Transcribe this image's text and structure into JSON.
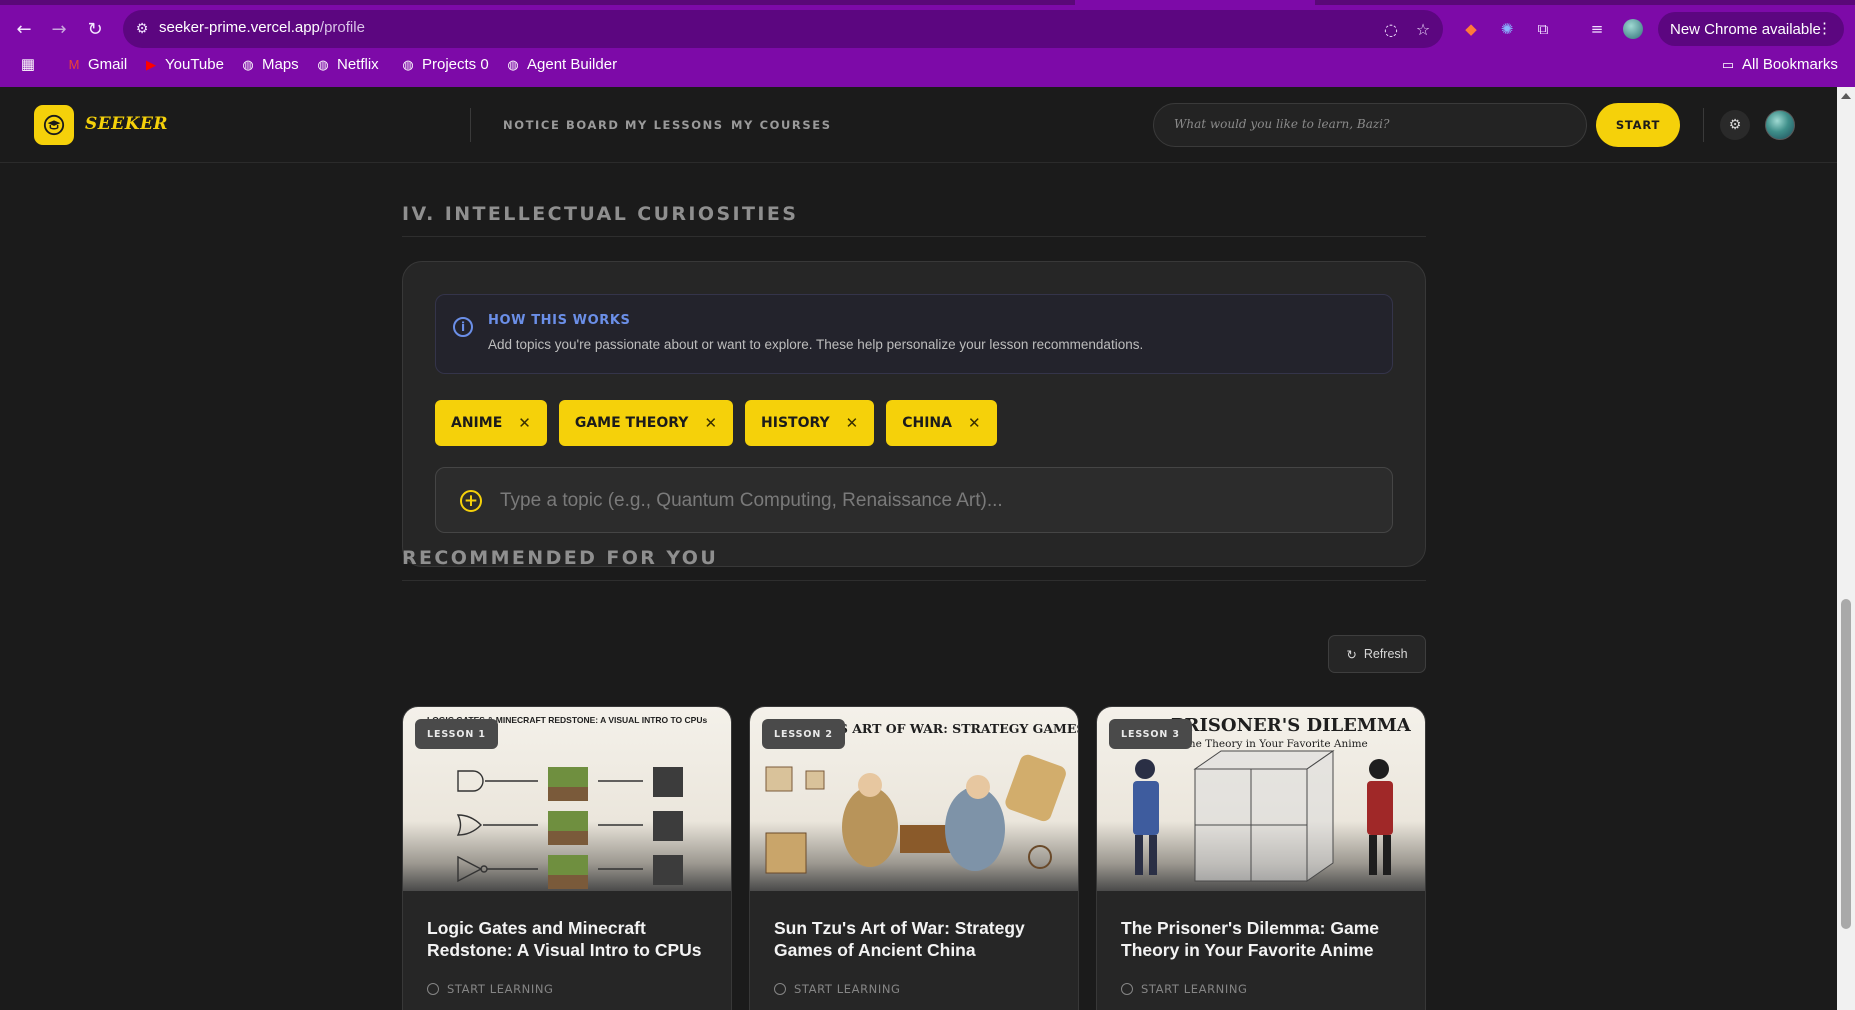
{
  "browser": {
    "url_host": "seeker-prime.vercel.app",
    "url_path": "/profile",
    "new_chrome_label": "New Chrome available",
    "bookmarks": [
      {
        "label": "Gmail",
        "icon": "gmail-icon"
      },
      {
        "label": "YouTube",
        "icon": "youtube-icon"
      },
      {
        "label": "Maps",
        "icon": "globe-icon"
      },
      {
        "label": "Netflix",
        "icon": "globe-icon"
      },
      {
        "label": "Projects 0",
        "icon": "globe-icon"
      },
      {
        "label": "Agent Builder",
        "icon": "globe-icon"
      }
    ],
    "all_bookmarks_label": "All Bookmarks"
  },
  "header": {
    "logo_text": "SEEKER",
    "nav": [
      "NOTICE BOARD",
      "MY LESSONS",
      "MY COURSES"
    ],
    "search_placeholder": "What would you like to learn, Bazi?",
    "start_label": "START"
  },
  "interests": {
    "section_title": "IV. INTELLECTUAL CURIOSITIES",
    "info_title": "HOW THIS WORKS",
    "info_text": "Add topics you're passionate about or want to explore. These help personalize your lesson recommendations.",
    "chips": [
      "ANIME",
      "GAME THEORY",
      "HISTORY",
      "CHINA"
    ],
    "input_placeholder": "Type a topic (e.g., Quantum Computing, Renaissance Art)..."
  },
  "recommended": {
    "section_title": "RECOMMENDED FOR YOU",
    "refresh_label": "Refresh",
    "lessons": [
      {
        "badge": "LESSON 1",
        "title": "Logic Gates and Minecraft Redstone: A Visual Intro to CPUs",
        "cta": "START LEARNING",
        "thumb_caption": "LOGIC GATES & MINECRAFT REDSTONE: A VISUAL INTRO TO CPUs"
      },
      {
        "badge": "LESSON 2",
        "title": "Sun Tzu's Art of War: Strategy Games of Ancient China",
        "cta": "START LEARNING",
        "thumb_caption": "SUN TZU'S ART OF WAR: STRATEGY GAMES OF ANCIENT CHINA"
      },
      {
        "badge": "LESSON 3",
        "title": "The Prisoner's Dilemma: Game Theory in Your Favorite Anime",
        "cta": "START LEARNING",
        "thumb_caption": "PRISONER'S DILEMMA",
        "thumb_subcaption": "Game Theory in Your Favorite Anime"
      }
    ]
  },
  "colors": {
    "accent": "#f5d10a",
    "browser_frame": "#7d0aa8",
    "background": "#1b1b1b",
    "info_blue": "#6b8fe8"
  }
}
